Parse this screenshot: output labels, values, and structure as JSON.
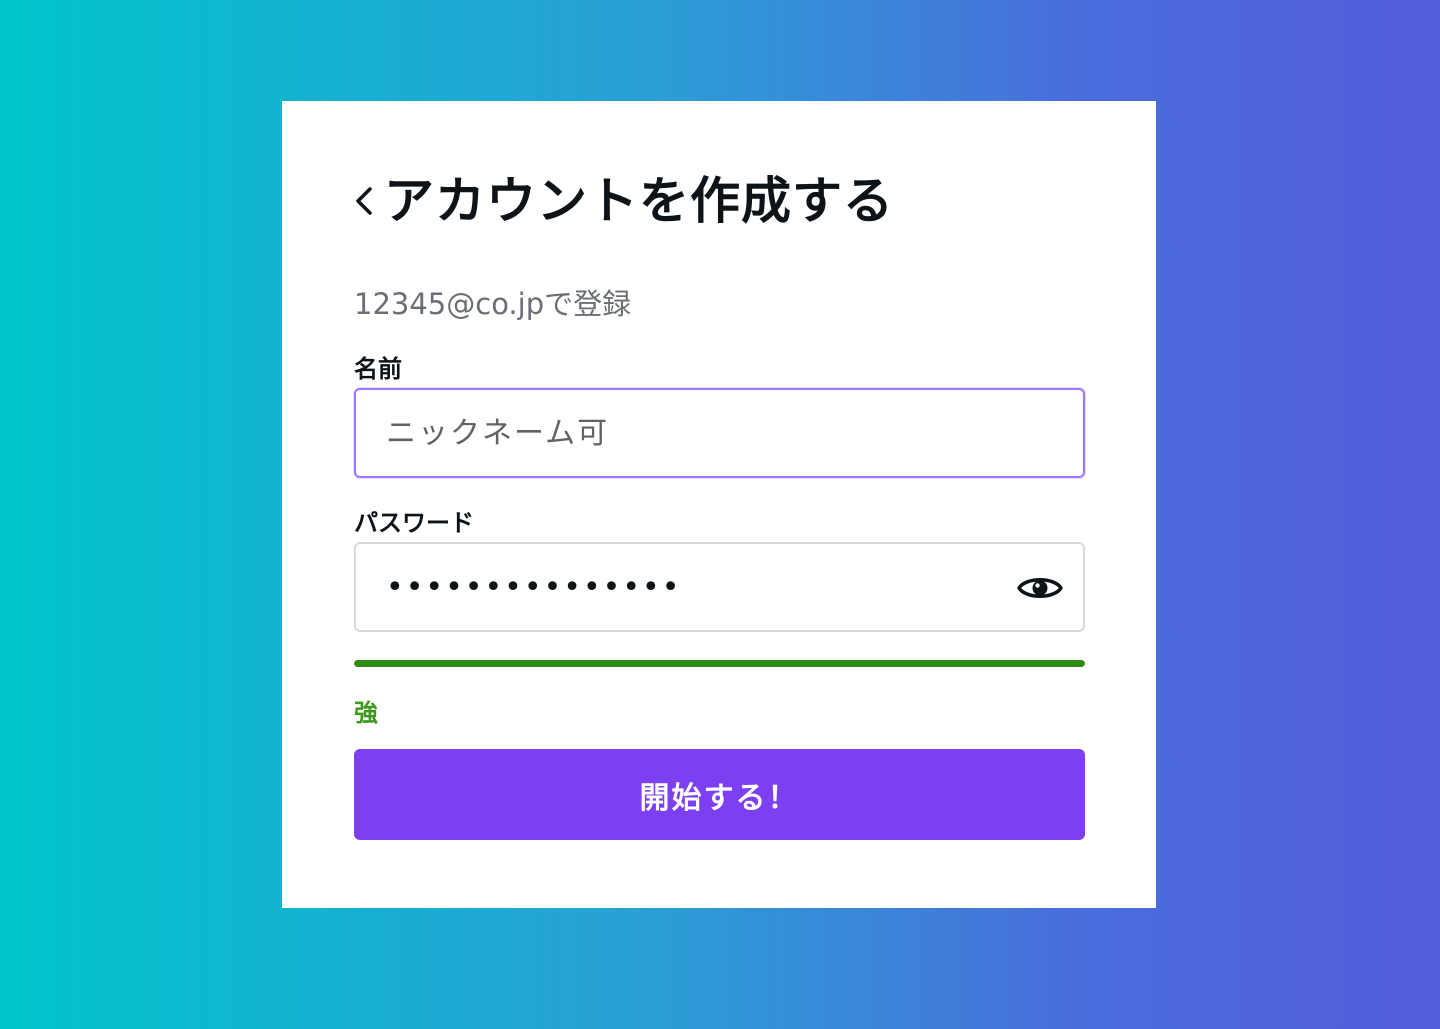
{
  "form": {
    "title": "アカウントを作成する",
    "register_text": "12345@co.jpで登録",
    "name_label": "名前",
    "name_placeholder": "ニックネーム可",
    "password_label": "パスワード",
    "password_value": "•••••••••••••••",
    "password_strength": 1.0,
    "strength_label": "強",
    "submit_label": "開始する！"
  },
  "icons": {
    "back": "chevron-left-icon",
    "reveal": "eye-icon"
  },
  "colors": {
    "gradient_start": "#00c4cc",
    "gradient_end": "#535cd9",
    "accent": "#7d3ff2",
    "focus_border": "#a277ff",
    "strength_strong": "#2e8b14"
  }
}
